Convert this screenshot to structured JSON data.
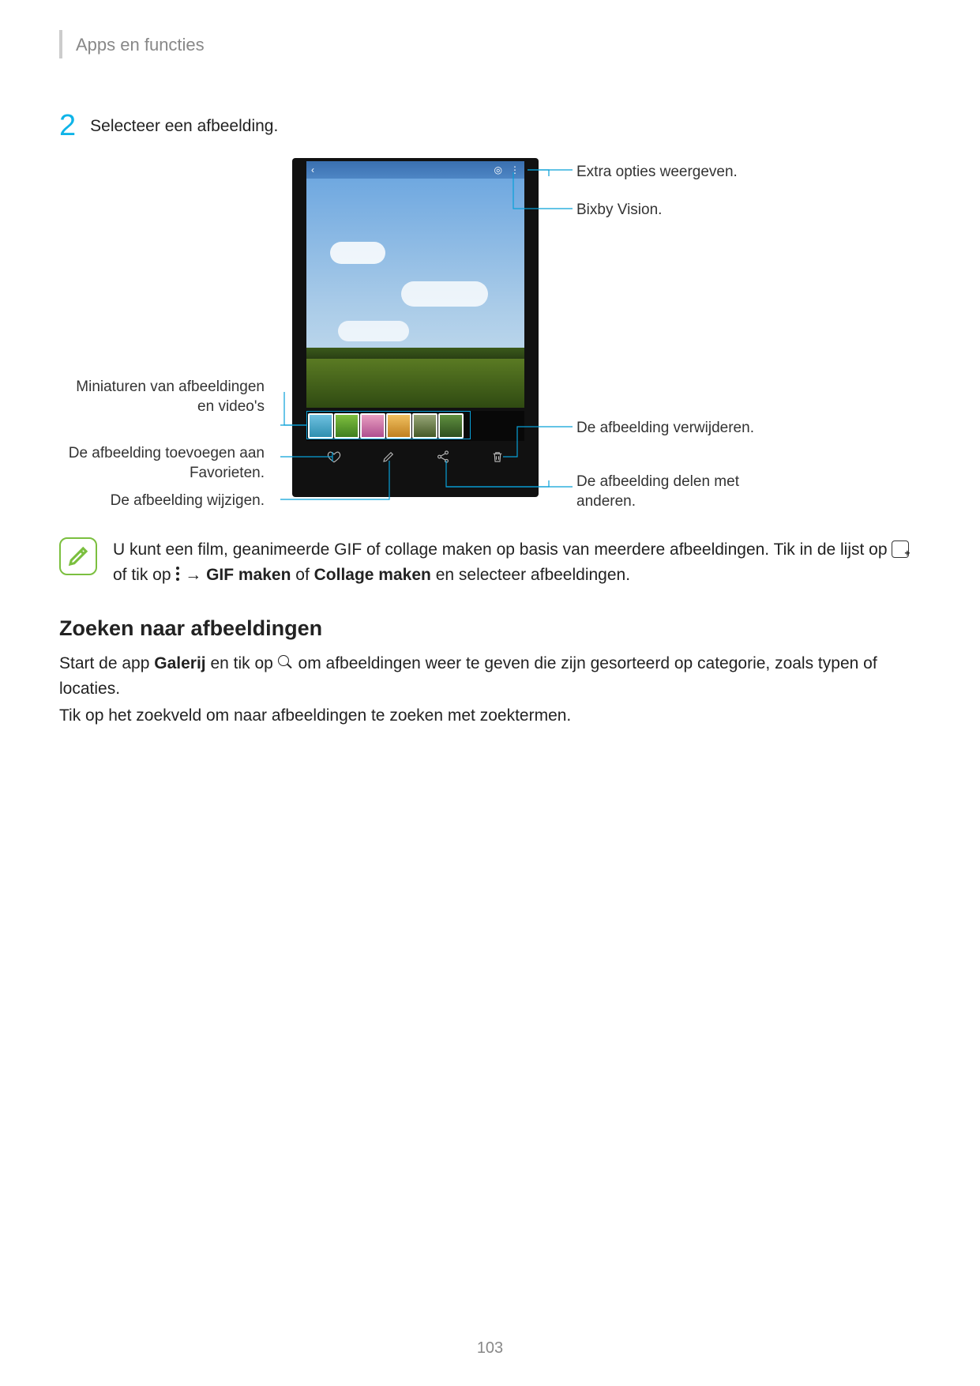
{
  "header": {
    "title": "Apps en functies"
  },
  "step": {
    "number": "2",
    "text": "Selecteer een afbeelding."
  },
  "callouts": {
    "extraOptions": "Extra opties weergeven.",
    "bixby": "Bixby Vision.",
    "thumbs": "Miniaturen van afbeeldingen en video's",
    "favorite": "De afbeelding toevoegen aan Favorieten.",
    "edit": "De afbeelding wijzigen.",
    "delete": "De afbeelding verwijderen.",
    "share": "De afbeelding delen met anderen."
  },
  "note": {
    "part1": "U kunt een film, geanimeerde GIF of collage maken op basis van meerdere afbeeldingen. Tik in de lijst op ",
    "part2": " of tik op ",
    "arrow": " → ",
    "gif": "GIF maken",
    "of": " of ",
    "collage": "Collage maken",
    "part3": " en selecteer afbeeldingen."
  },
  "section": {
    "heading": "Zoeken naar afbeeldingen",
    "para1a": "Start de app ",
    "galerij": "Galerij",
    "para1b": " en tik op ",
    "para1c": " om afbeeldingen weer te geven die zijn gesorteerd op categorie, zoals typen of locaties.",
    "para2": "Tik op het zoekveld om naar afbeeldingen te zoeken met zoektermen."
  },
  "pageNumber": "103"
}
